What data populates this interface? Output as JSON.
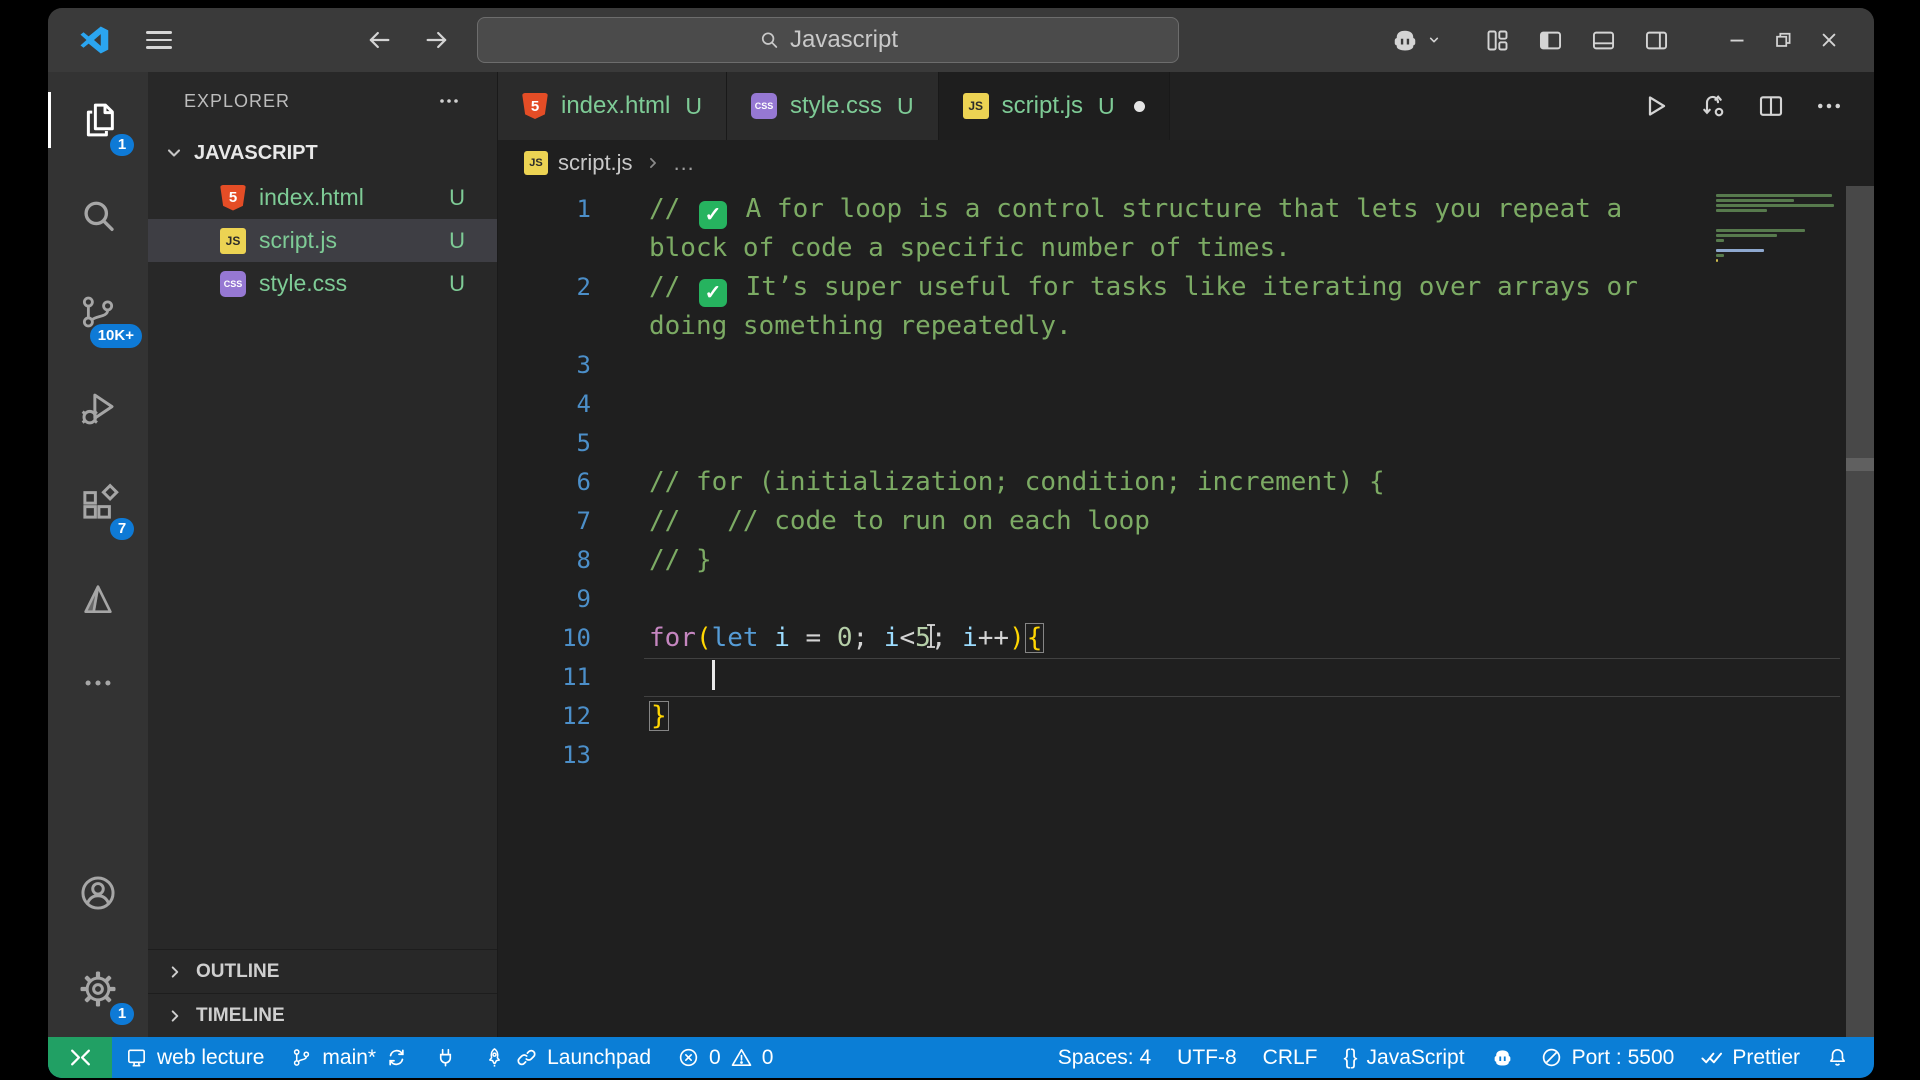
{
  "title_bar": {
    "search_value": "Javascript",
    "window_controls": [
      "minimize",
      "maximize",
      "close"
    ]
  },
  "activity_bar": {
    "explorer_badge": "1",
    "scm_badge": "10K+",
    "extensions_badge": "7",
    "settings_badge": "1"
  },
  "sidebar": {
    "header": "EXPLORER",
    "folder": "JAVASCRIPT",
    "files": [
      {
        "name": "index.html",
        "type": "html",
        "icon_text": "5",
        "git": "U",
        "selected": false
      },
      {
        "name": "script.js",
        "type": "js",
        "icon_text": "JS",
        "git": "U",
        "selected": true
      },
      {
        "name": "style.css",
        "type": "css",
        "icon_text": "CSS",
        "git": "U",
        "selected": false
      }
    ],
    "sections": [
      "OUTLINE",
      "TIMELINE"
    ]
  },
  "tabs": [
    {
      "name": "index.html",
      "type": "html",
      "icon_text": "5",
      "git": "U",
      "active": false,
      "modified": false
    },
    {
      "name": "style.css",
      "type": "css",
      "icon_text": "CSS",
      "git": "U",
      "active": false,
      "modified": false
    },
    {
      "name": "script.js",
      "type": "js",
      "icon_text": "JS",
      "git": "U",
      "active": true,
      "modified": true
    }
  ],
  "breadcrumb": {
    "file": "script.js",
    "more": "…",
    "icon_text": "JS"
  },
  "editor": {
    "check_glyph": "✓",
    "lines": [
      {
        "num": 1,
        "parts": [
          [
            "// ",
            "c"
          ],
          [
            "✓",
            "emoji"
          ],
          [
            " A for loop is a control structure that lets you repeat a",
            "c"
          ]
        ],
        "wrap": "block of code a specific number of times."
      },
      {
        "num": 2,
        "parts": [
          [
            "// ",
            "c"
          ],
          [
            "✓",
            "emoji"
          ],
          [
            " It’s super useful for tasks like iterating over arrays or",
            "c"
          ]
        ],
        "wrap": "doing something repeatedly."
      },
      {
        "num": 3,
        "parts": []
      },
      {
        "num": 4,
        "parts": []
      },
      {
        "num": 5,
        "parts": []
      },
      {
        "num": 6,
        "parts": [
          [
            "// for (initialization; condition; increment) {",
            "c"
          ]
        ]
      },
      {
        "num": 7,
        "parts": [
          [
            "//   // code to run on each loop",
            "c"
          ]
        ]
      },
      {
        "num": 8,
        "parts": [
          [
            "// }",
            "c"
          ]
        ]
      },
      {
        "num": 9,
        "parts": []
      },
      {
        "num": 10,
        "parts": [
          [
            "for",
            "k"
          ],
          [
            "(",
            "b"
          ],
          [
            "let",
            "s"
          ],
          [
            " ",
            "p"
          ],
          [
            "i",
            "v"
          ],
          [
            " = ",
            "p"
          ],
          [
            "0",
            "n"
          ],
          [
            "; ",
            "p"
          ],
          [
            "i",
            "v"
          ],
          [
            "<",
            "p"
          ],
          [
            "5",
            "n"
          ],
          [
            "",
            "ib"
          ],
          [
            "; ",
            "p"
          ],
          [
            "i",
            "v"
          ],
          [
            "++",
            "p"
          ],
          [
            ")",
            "b"
          ],
          [
            "{",
            "bm"
          ]
        ]
      },
      {
        "num": 11,
        "parts": [
          [
            "    ",
            "p"
          ]
        ],
        "cursor": true,
        "boxed": true
      },
      {
        "num": 12,
        "parts": [
          [
            "}",
            "bm"
          ]
        ]
      },
      {
        "num": 13,
        "parts": []
      }
    ]
  },
  "status_bar": {
    "left": [
      {
        "name": "web-lecture",
        "parts": [
          {
            "icon": "screen"
          },
          {
            "text": "web lecture"
          }
        ]
      },
      {
        "name": "git-branch",
        "parts": [
          {
            "icon": "branch"
          },
          {
            "text": "main*"
          },
          {
            "icon": "sync"
          }
        ]
      },
      {
        "name": "ports",
        "parts": [
          {
            "icon": "plug"
          }
        ]
      },
      {
        "name": "launchpad",
        "parts": [
          {
            "icon": "rocket"
          },
          {
            "icon": "link"
          },
          {
            "text": "Launchpad"
          }
        ]
      },
      {
        "name": "problems",
        "parts": [
          {
            "icon": "error"
          },
          {
            "text": "0"
          },
          {
            "icon": "warning"
          },
          {
            "text": "0"
          }
        ]
      }
    ],
    "right": [
      {
        "name": "indentation",
        "parts": [
          {
            "text": "Spaces: 4"
          }
        ]
      },
      {
        "name": "encoding",
        "parts": [
          {
            "text": "UTF-8"
          }
        ]
      },
      {
        "name": "eol",
        "parts": [
          {
            "text": "CRLF"
          }
        ]
      },
      {
        "name": "language",
        "parts": [
          {
            "text": "{}"
          },
          {
            "text": "JavaScript"
          }
        ]
      },
      {
        "name": "copilot",
        "parts": [
          {
            "icon": "copilot"
          }
        ]
      },
      {
        "name": "live-port",
        "parts": [
          {
            "icon": "slash"
          },
          {
            "text": "Port : 5500"
          }
        ]
      },
      {
        "name": "prettier",
        "parts": [
          {
            "icon": "dblcheck"
          },
          {
            "text": "Prettier"
          }
        ]
      },
      {
        "name": "notifications",
        "parts": [
          {
            "icon": "bell"
          }
        ]
      }
    ]
  },
  "colors": {
    "statusbar": "#0b7ed6",
    "remote_green": "#21a064",
    "badge_blue": "#0e7ad6",
    "git_untracked": "#7ecb96",
    "comment": "#7cab64",
    "keyword": "#C586C0",
    "storage": "#569CD6",
    "variable": "#9CDCFE",
    "number": "#B5CEA8",
    "bracket": "#ffd602",
    "line_number": "#4c8fc9"
  }
}
